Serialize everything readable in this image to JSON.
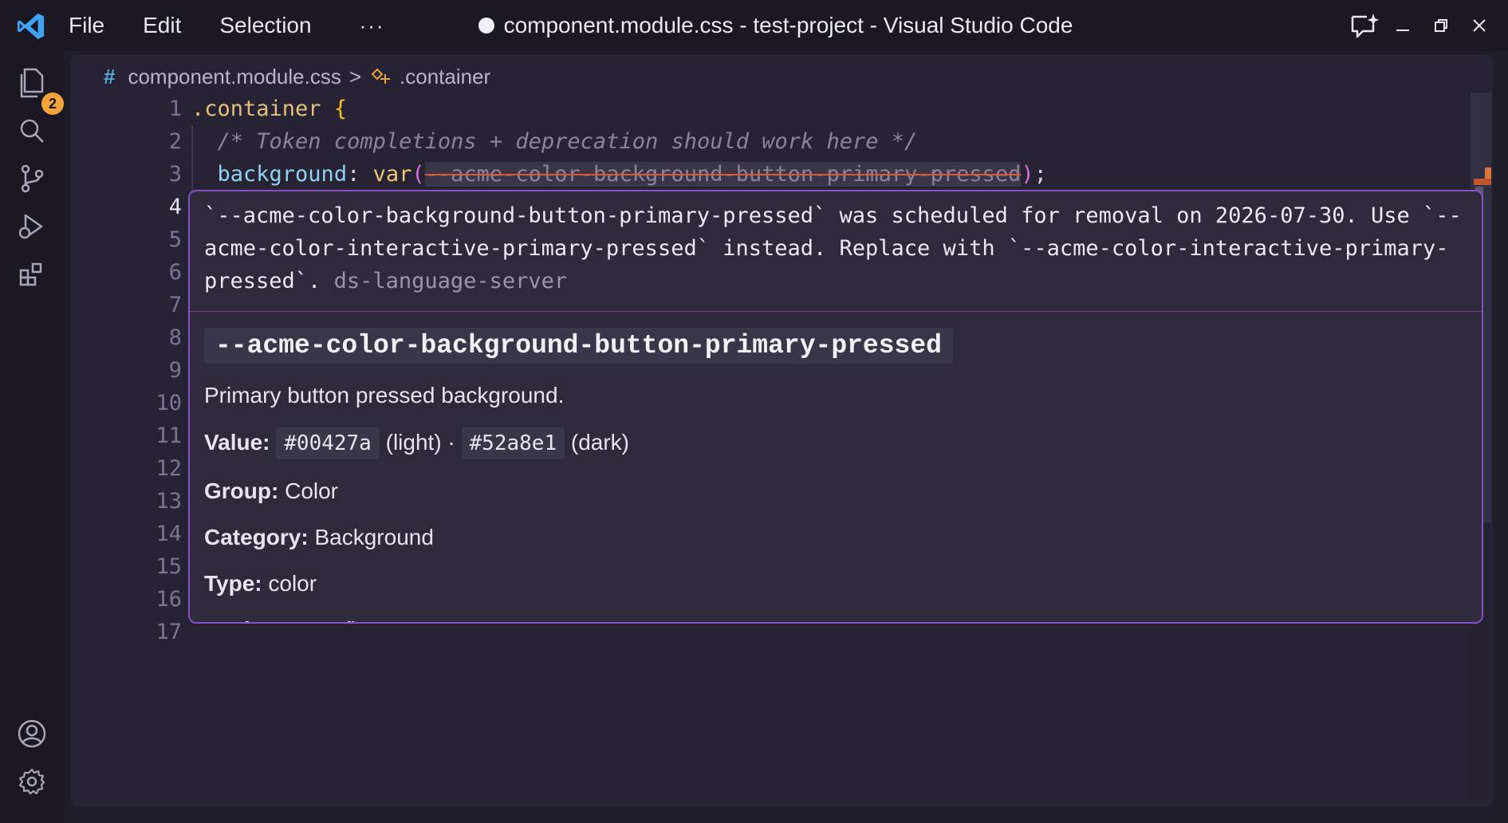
{
  "window": {
    "title": "component.module.css - test-project - Visual Studio Code",
    "menu": [
      "File",
      "Edit",
      "Selection",
      "···"
    ]
  },
  "activity_bar": {
    "explorer_badge": "2"
  },
  "breadcrumb": {
    "file": "component.module.css",
    "symbol": ".container"
  },
  "editor": {
    "line_numbers": [
      "1",
      "2",
      "3",
      "4",
      "5",
      "6",
      "7",
      "8",
      "9",
      "10",
      "11",
      "12",
      "13",
      "14",
      "15",
      "16",
      "17"
    ],
    "active_line": "4",
    "code": {
      "line1_selector": ".container",
      "line1_brace": "{",
      "line2_comment": "/* Token completions + deprecation should work here */",
      "line3_property": "background",
      "line3_colon": ": ",
      "line3_fn": "var",
      "line3_open": "(",
      "line3_token": "--acme-color-background-button-primary-pressed",
      "line3_close": ")",
      "line3_semicolon": ";"
    }
  },
  "hover": {
    "diagnostic": "`--acme-color-background-button-primary-pressed` was scheduled for removal on 2026-07-30. Use `--acme-color-interactive-primary-pressed` instead. Replace with `--acme-color-interactive-primary-pressed`.",
    "source": "ds-language-server",
    "token_name": "--acme-color-background-button-primary-pressed",
    "description": "Primary button pressed background.",
    "value_label": "Value:",
    "value_light": "#00427a",
    "light_text": "(light) ·",
    "value_dark": "#52a8e1",
    "dark_text": "(dark)",
    "group_label": "Group:",
    "group_value": "Color",
    "category_label": "Category:",
    "category_value": "Background",
    "type_label": "Type:",
    "type_value": "color",
    "package_label": "Package:",
    "package_value": "config"
  },
  "colors": {
    "accent_border": "#8b4fc4",
    "badge": "#f2a33a",
    "strike": "#e0563c"
  }
}
